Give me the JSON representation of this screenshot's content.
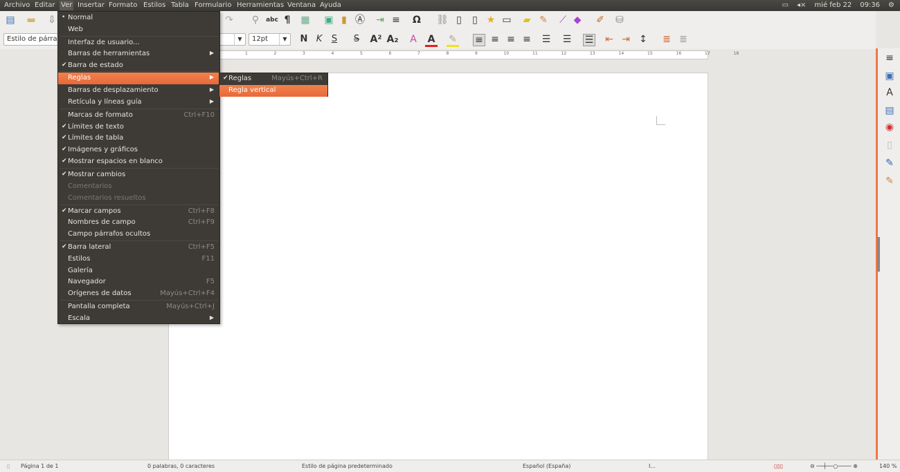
{
  "menubar": [
    "Archivo",
    "Editar",
    "Ver",
    "Insertar",
    "Formato",
    "Estilos",
    "Tabla",
    "Formulario",
    "Herramientas",
    "Ventana",
    "Ayuda"
  ],
  "tray": {
    "date": "mié feb 22",
    "time": "09:36"
  },
  "toolbar": {
    "paragraph_style": "Estilo de párrafo",
    "font_size": "12pt",
    "bold": "N",
    "italic": "K",
    "underline": "S"
  },
  "ruler_ticks": [
    "1",
    "2",
    "3",
    "4",
    "5",
    "6",
    "7",
    "8",
    "9",
    "10",
    "11",
    "12",
    "13",
    "14",
    "15",
    "16",
    "17",
    "18"
  ],
  "view_menu": [
    {
      "label": "Normal",
      "mark": "•"
    },
    {
      "label": "Web"
    },
    {
      "label": "Interfaz de usuario...",
      "sep": true
    },
    {
      "label": "Barras de herramientas",
      "submenu": true
    },
    {
      "label": "Barra de estado",
      "mark": "✔"
    },
    {
      "label": "Reglas",
      "submenu": true,
      "highlight": true,
      "sep": true
    },
    {
      "label": "Barras de desplazamiento",
      "submenu": true
    },
    {
      "label": "Retícula y líneas guía",
      "submenu": true
    },
    {
      "label": "Marcas de formato",
      "shortcut": "Ctrl+F10",
      "sep": true
    },
    {
      "label": "Límites de texto",
      "mark": "✔"
    },
    {
      "label": "Límites de tabla",
      "mark": "✔"
    },
    {
      "label": "Imágenes y gráficos",
      "mark": "✔"
    },
    {
      "label": "Mostrar espacios en blanco",
      "mark": "✔"
    },
    {
      "label": "Mostrar cambios",
      "mark": "✔",
      "sep": true
    },
    {
      "label": "Comentarios",
      "disabled": true
    },
    {
      "label": "Comentarios resueltos",
      "disabled": true
    },
    {
      "label": "Marcar campos",
      "mark": "✔",
      "shortcut": "Ctrl+F8",
      "sep": true
    },
    {
      "label": "Nombres de campo",
      "shortcut": "Ctrl+F9"
    },
    {
      "label": "Campo párrafos ocultos"
    },
    {
      "label": "Barra lateral",
      "mark": "✔",
      "shortcut": "Ctrl+F5",
      "sep": true
    },
    {
      "label": "Estilos",
      "shortcut": "F11"
    },
    {
      "label": "Galería"
    },
    {
      "label": "Navegador",
      "shortcut": "F5"
    },
    {
      "label": "Orígenes de datos",
      "shortcut": "Mayús+Ctrl+F4"
    },
    {
      "label": "Pantalla completa",
      "shortcut": "Mayús+Ctrl+J",
      "sep": true
    },
    {
      "label": "Escala",
      "submenu": true
    }
  ],
  "rulers_submenu": [
    {
      "label": "Reglas",
      "mark": "✔",
      "shortcut": "Mayús+Ctrl+R"
    },
    {
      "label": "Regla vertical",
      "highlight": true
    }
  ],
  "status": {
    "page": "Página 1 de 1",
    "words": "0 palabras, 0 caracteres",
    "page_style": "Estilo de página predeterminado",
    "language": "Español (España)",
    "insert": "I...",
    "zoom": "140 %"
  },
  "colors": {
    "accent": "#f07746",
    "menu_bg": "#3e3b37",
    "topbar": "#3c3b37"
  }
}
